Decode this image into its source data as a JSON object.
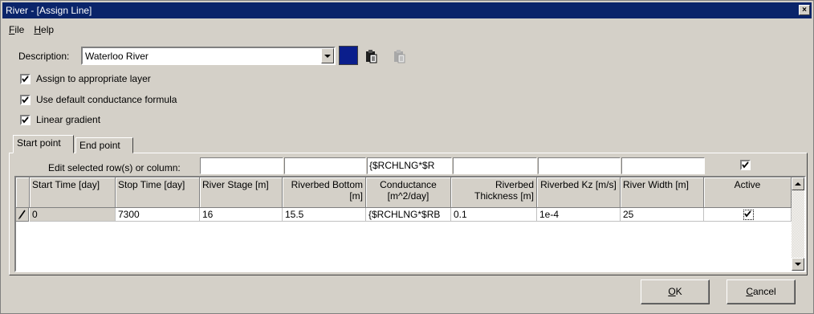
{
  "window": {
    "title": "River - [Assign Line]",
    "close_glyph": "×"
  },
  "menu": {
    "file": "File",
    "help": "Help"
  },
  "description": {
    "label": "Description:",
    "value": "Waterloo River",
    "color": "#0a1e8c",
    "icons": [
      "paste-icon",
      "paste-disabled-icon"
    ]
  },
  "options": [
    {
      "label": "Assign to appropriate layer",
      "checked": true
    },
    {
      "label": "Use default conductance formula",
      "checked": true
    },
    {
      "label": "Linear gradient",
      "checked": true
    }
  ],
  "tabs": [
    {
      "label": "Start point",
      "active": true
    },
    {
      "label": "End point",
      "active": false
    }
  ],
  "edit_row": {
    "label": "Edit selected row(s) or column:",
    "values": [
      "",
      "",
      "",
      "{$RCHLNG*$R",
      "",
      "",
      "",
      ""
    ],
    "active_checked": true
  },
  "table": {
    "columns": [
      "Start Time [day]",
      "Stop Time [day]",
      "River Stage [m]",
      "Riverbed Bottom [m]",
      "Conductance [m^2/day]",
      "Riverbed Thickness [m]",
      "Riverbed Kz [m/s]",
      "River Width [m]",
      "Active"
    ],
    "rows": [
      {
        "cells": [
          "0",
          "7300",
          "16",
          "15.5",
          "{$RCHLNG*$RB",
          "0.1",
          "1e-4",
          "25"
        ],
        "active": true
      }
    ]
  },
  "buttons": {
    "ok": "OK",
    "cancel": "Cancel"
  }
}
